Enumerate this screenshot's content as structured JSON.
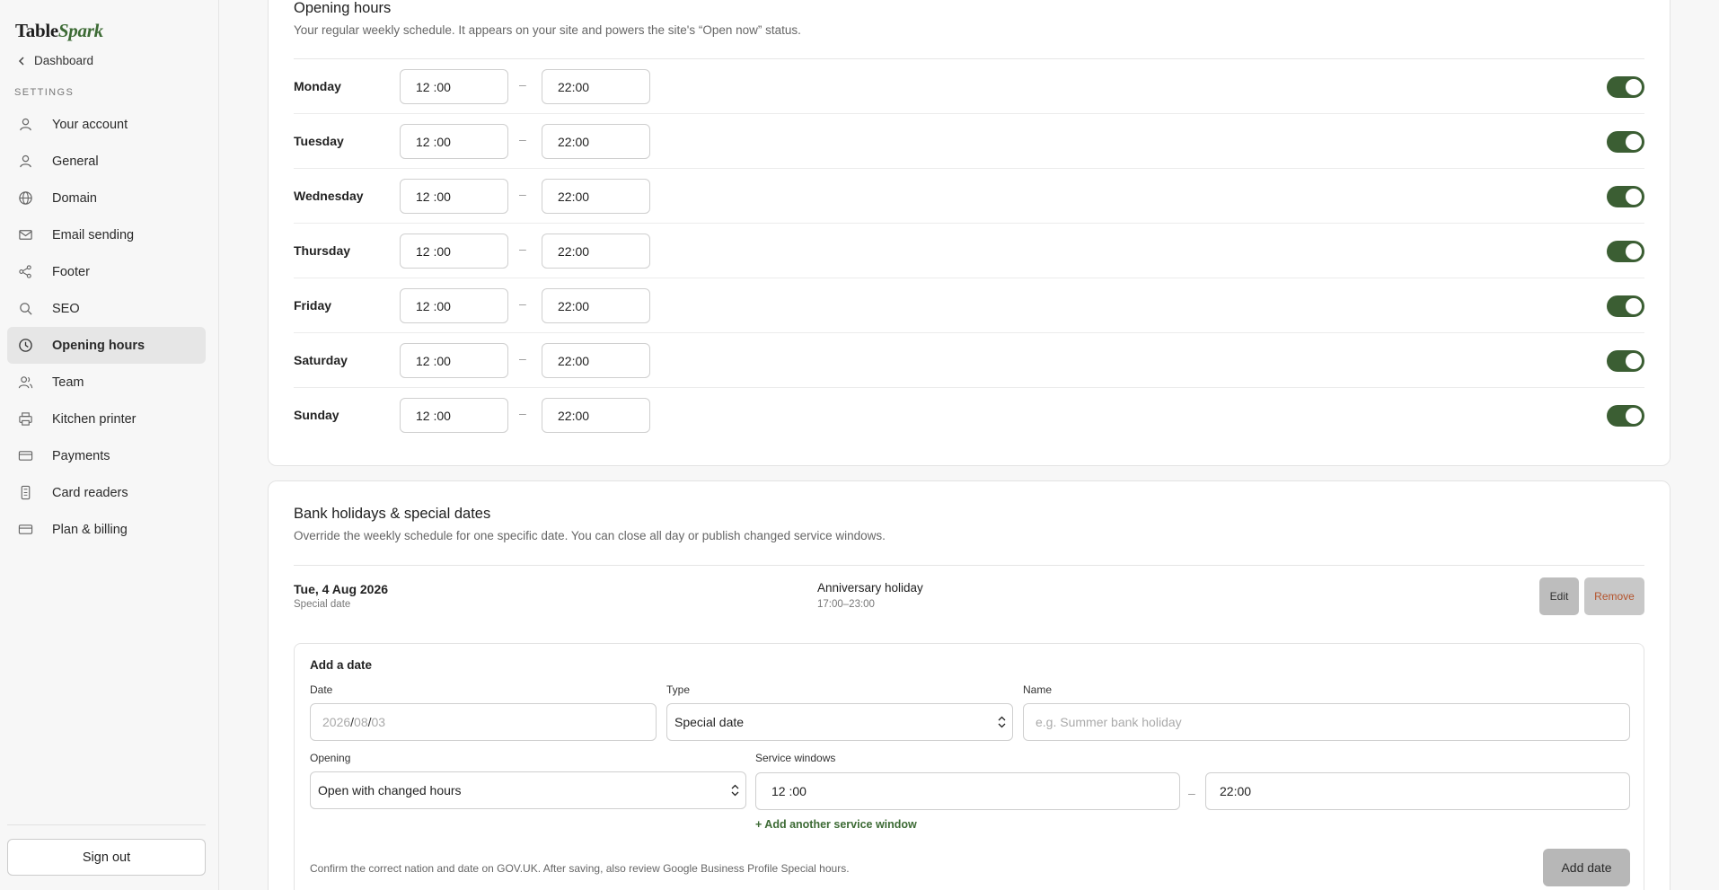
{
  "brand": {
    "name_part1": "Table",
    "name_part2": "Spark",
    "accent_color": "#3d6b35"
  },
  "sidebar": {
    "back_label": "Dashboard",
    "settings_heading": "SETTINGS",
    "items": [
      {
        "label": "Your account",
        "icon": "user-icon"
      },
      {
        "label": "General",
        "icon": "user-icon"
      },
      {
        "label": "Domain",
        "icon": "globe-icon"
      },
      {
        "label": "Email sending",
        "icon": "mail-icon"
      },
      {
        "label": "Footer",
        "icon": "share-icon"
      },
      {
        "label": "SEO",
        "icon": "search-icon"
      },
      {
        "label": "Opening hours",
        "icon": "clock-icon",
        "active": true
      },
      {
        "label": "Team",
        "icon": "users-icon"
      },
      {
        "label": "Kitchen printer",
        "icon": "printer-icon"
      },
      {
        "label": "Payments",
        "icon": "credit-card-icon"
      },
      {
        "label": "Card readers",
        "icon": "card-reader-icon"
      },
      {
        "label": "Plan & billing",
        "icon": "credit-card-icon"
      }
    ],
    "signout_label": "Sign out"
  },
  "opening_hours": {
    "title": "Opening hours",
    "description": "Your regular weekly schedule. It appears on your site and powers the site's “Open now” status.",
    "separator": "–",
    "toggle_color": "#3b5e33",
    "days": [
      {
        "name": "Monday",
        "open": "12 :00",
        "close": "22:00",
        "enabled": true
      },
      {
        "name": "Tuesday",
        "open": "12 :00",
        "close": "22:00",
        "enabled": true
      },
      {
        "name": "Wednesday",
        "open": "12 :00",
        "close": "22:00",
        "enabled": true
      },
      {
        "name": "Thursday",
        "open": "12 :00",
        "close": "22:00",
        "enabled": true
      },
      {
        "name": "Friday",
        "open": "12 :00",
        "close": "22:00",
        "enabled": true
      },
      {
        "name": "Saturday",
        "open": "12 :00",
        "close": "22:00",
        "enabled": true
      },
      {
        "name": "Sunday",
        "open": "12 :00",
        "close": "22:00",
        "enabled": true
      }
    ]
  },
  "holidays": {
    "title": "Bank holidays & special dates",
    "description": "Override the weekly schedule for one specific date. You can close all day or publish changed service windows.",
    "entry": {
      "date": "Tue, 4 Aug 2026",
      "type": "Special date",
      "name": "Anniversary holiday",
      "time": "17:00–23:00",
      "edit_label": "Edit",
      "remove_label": "Remove"
    },
    "add": {
      "title": "Add a date",
      "date_label": "Date",
      "date_year": "2026",
      "date_month": "08",
      "date_day": "03",
      "date_sep": "/",
      "type_label": "Type",
      "type_value": "Special date",
      "name_label": "Name",
      "name_placeholder": "e.g. Summer bank holiday",
      "opening_label": "Opening",
      "opening_value": "Open with changed hours",
      "service_label": "Service windows",
      "service_open": "12 :00",
      "service_close": "22:00",
      "service_sep": "–",
      "add_service_label": "+ Add another service window",
      "help_text": "Confirm the correct nation and date on GOV.UK. After saving, also review Google Business Profile Special hours.",
      "submit_label": "Add date"
    }
  }
}
